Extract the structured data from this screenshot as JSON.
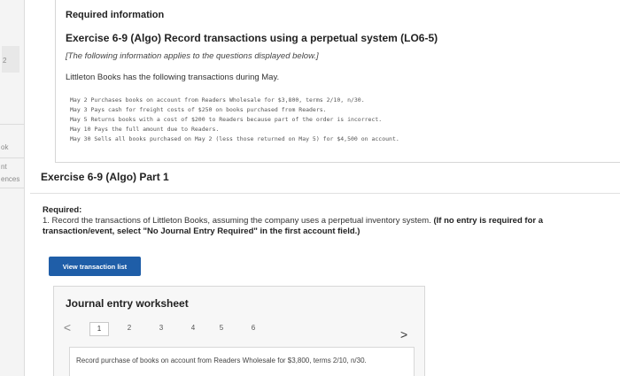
{
  "rail": {
    "num": "2",
    "ok": "ok",
    "nt": "nt",
    "ences": "ences"
  },
  "info": {
    "title": "Required information",
    "exercise_title": "Exercise 6-9 (Algo) Record transactions using a perpetual system (LO6-5)",
    "note": "[The following information applies to the questions displayed below.]",
    "intro": "Littleton Books has the following transactions during May.",
    "transactions": [
      "May 2  Purchases books on account from Readers Wholesale for $3,800, terms 2/10, n/30.",
      "May 3  Pays cash for freight costs of $250 on books purchased from Readers.",
      "May 5  Returns books with a cost of $200 to Readers because part of the order is incorrect.",
      "May 10 Pays the full amount due to Readers.",
      "May 30 Sells all books purchased on May 2 (less those returned on May 5) for $4,500 on account."
    ]
  },
  "part": {
    "title": "Exercise 6-9 (Algo) Part 1"
  },
  "required": {
    "label": "Required:",
    "text_plain": "1. Record the transactions of Littleton Books, assuming the company uses a perpetual inventory system.",
    "text_bold": "(If no entry is required for a transaction/event, select \"No Journal Entry Required\" in the first account field.)"
  },
  "buttons": {
    "view_transaction_list": "View transaction list"
  },
  "worksheet": {
    "title": "Journal entry worksheet",
    "prev": "<",
    "next": ">",
    "pages": [
      "1",
      "2",
      "3",
      "4",
      "5",
      "6"
    ],
    "active_page": "1",
    "entry_text": "Record purchase of books on account from Readers Wholesale for $3,800, terms 2/10, n/30."
  }
}
